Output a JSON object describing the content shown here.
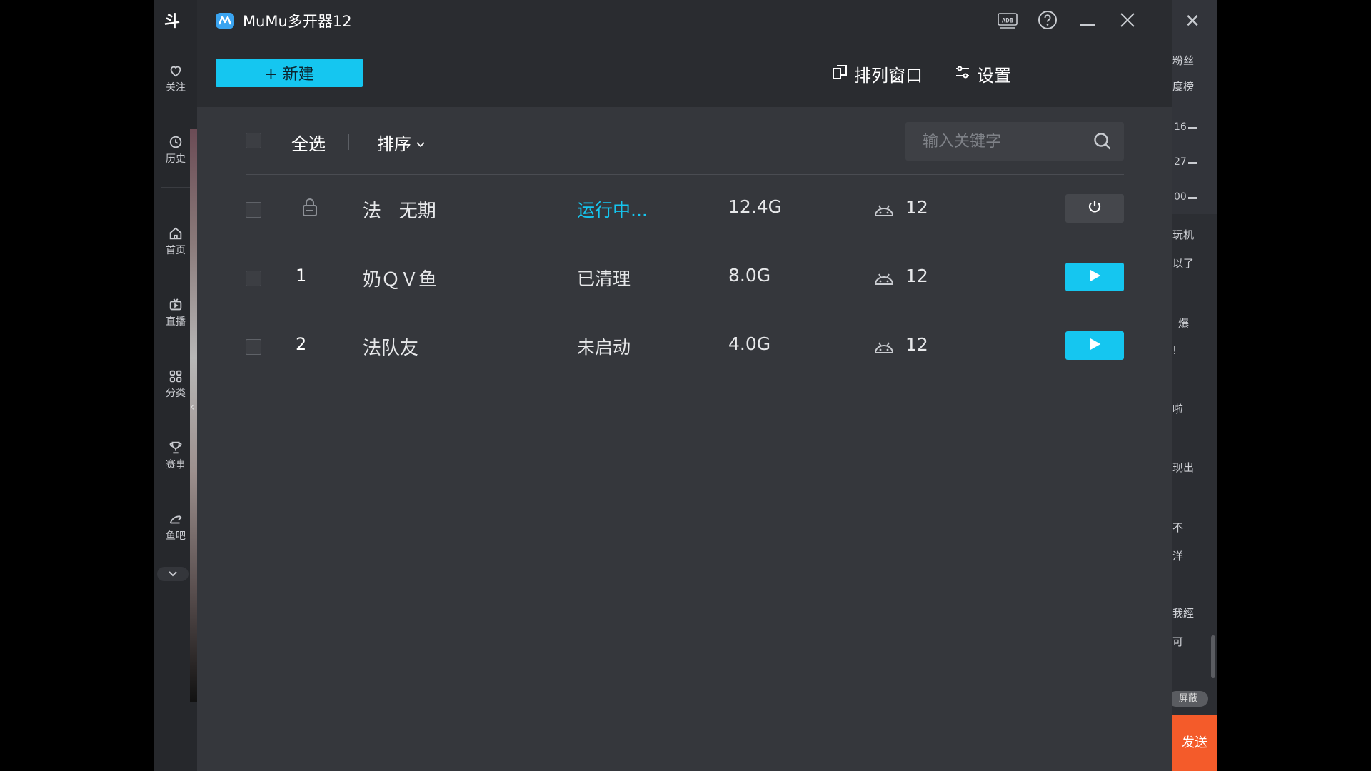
{
  "background_app": {
    "logo": "斗",
    "nav": [
      {
        "label": "关注",
        "icon": "heart-icon"
      },
      {
        "label": "历史",
        "icon": "clock-icon"
      },
      {
        "label": "首页",
        "icon": "home-icon"
      },
      {
        "label": "直播",
        "icon": "tv-icon"
      },
      {
        "label": "分类",
        "icon": "grid-icon"
      },
      {
        "label": "赛事",
        "icon": "trophy-icon"
      },
      {
        "label": "鱼吧",
        "icon": "fish-icon"
      }
    ],
    "right_panel": {
      "tab_fans": "粉丝",
      "tab_rank": "度榜",
      "numbers": [
        "16",
        "27",
        "00"
      ],
      "chat_fragments": [
        "玩机",
        "以了",
        "爆",
        "!",
        "啦",
        "现出",
        "不",
        "洋",
        "我經",
        "可"
      ],
      "block_label": "屏蔽",
      "send_label": "发送"
    }
  },
  "window": {
    "title": "MuMu多开器12",
    "controls": {
      "adb_label": "ADB"
    },
    "toolbar": {
      "new_label": "+ 新建",
      "arrange_label": "排列窗口",
      "settings_label": "设置"
    },
    "filter": {
      "select_all_label": "全选",
      "sort_label": "排序",
      "search_placeholder": "输入关键字"
    },
    "instances": [
      {
        "index": "",
        "locked": true,
        "name": "法   无期",
        "status": "运行中...",
        "running": true,
        "size": "12.4G",
        "android": "12",
        "action": "power"
      },
      {
        "index": "1",
        "locked": false,
        "name": "奶ＱＶ鱼",
        "status": "已清理",
        "running": false,
        "size": "8.0G",
        "android": "12",
        "action": "play"
      },
      {
        "index": "2",
        "locked": false,
        "name": "法队友",
        "status": "未启动",
        "running": false,
        "size": "4.0G",
        "android": "12",
        "action": "play"
      }
    ]
  },
  "colors": {
    "accent": "#15c6f0",
    "window_bg": "#2a2c30",
    "content_bg": "#35373c",
    "send_bg": "#f45b2a"
  }
}
